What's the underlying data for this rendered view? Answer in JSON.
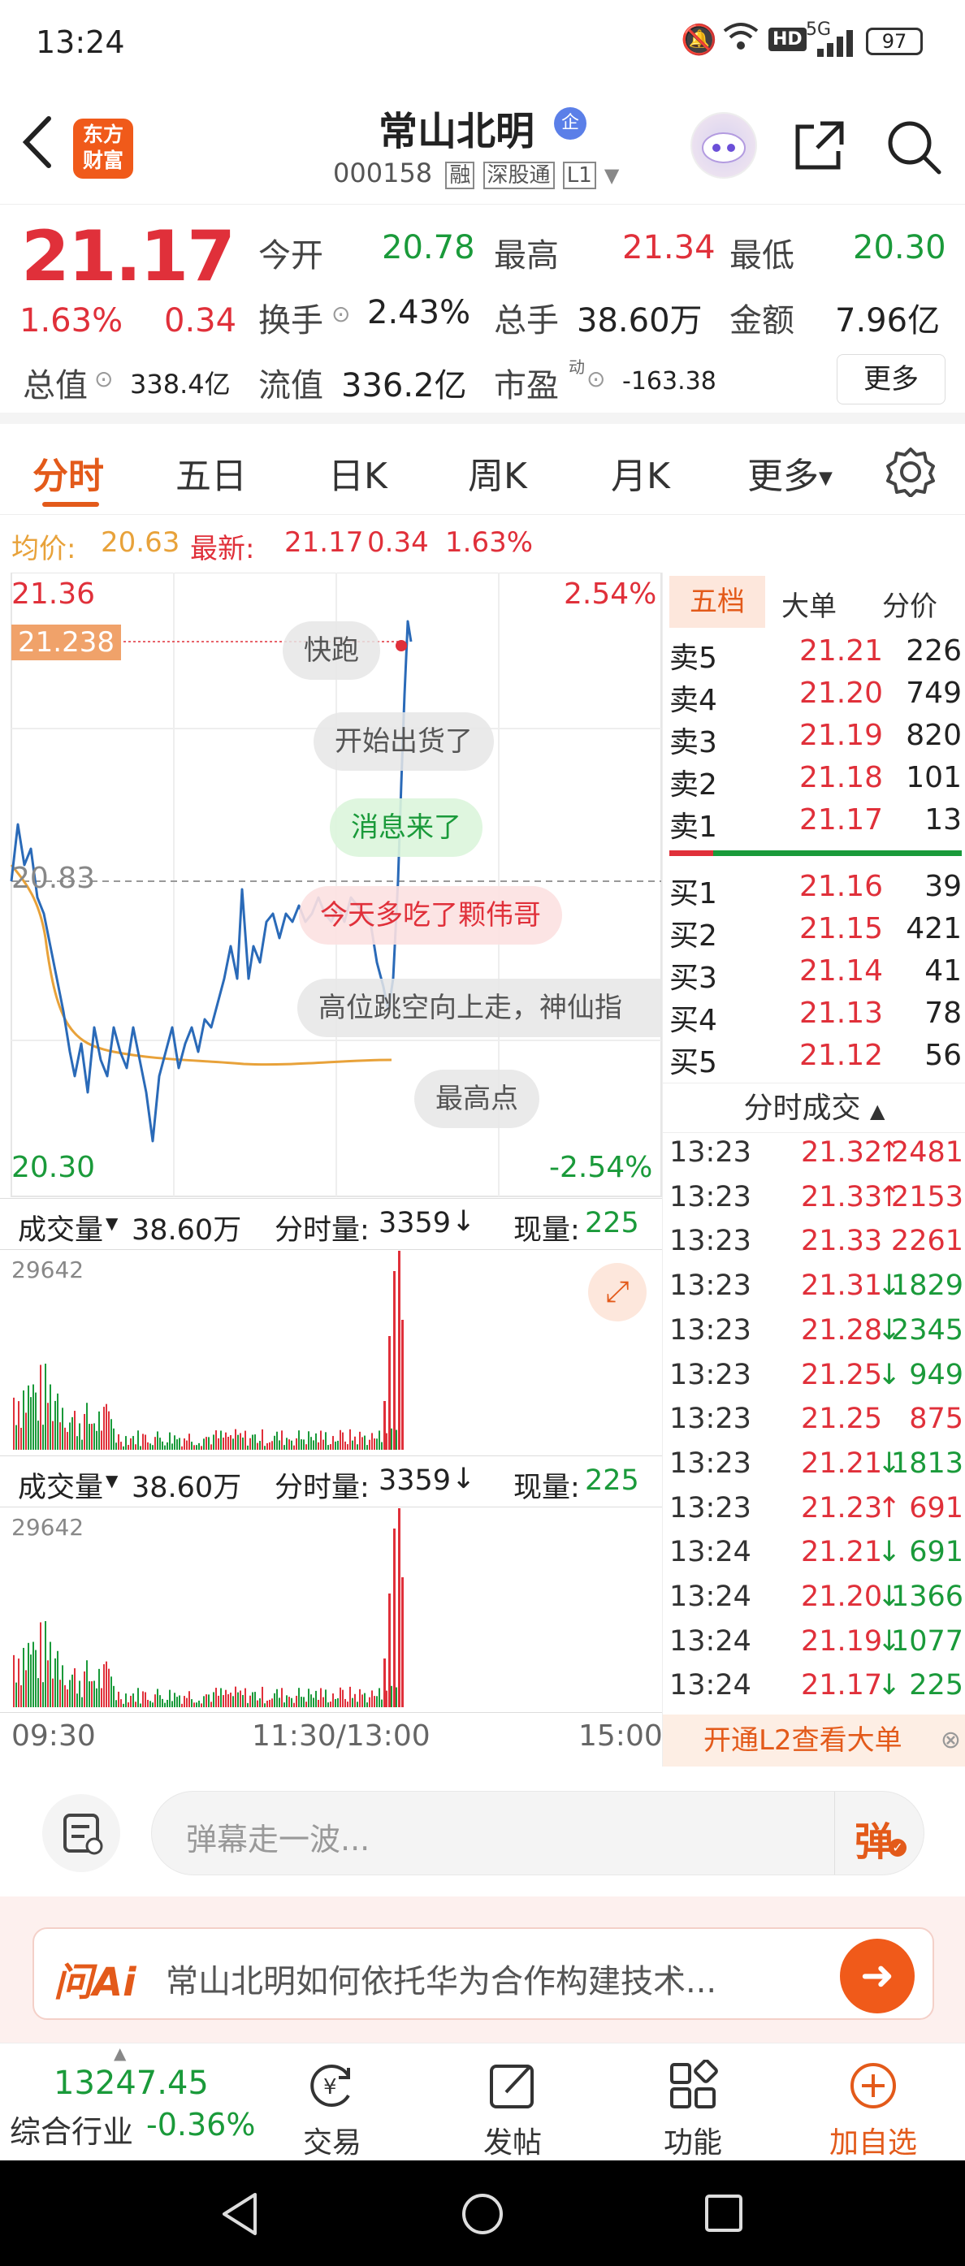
{
  "status": {
    "time": "13:24",
    "network": "5G",
    "battery": "97"
  },
  "header": {
    "name": "常山北明",
    "badge": "企",
    "code": "000158",
    "tags": [
      "融",
      "深股通",
      "L1"
    ],
    "logo_line1": "东方",
    "logo_line2": "财富"
  },
  "quote": {
    "price": "21.17",
    "change_pct": "1.63%",
    "change": "0.34",
    "open_label": "今开",
    "open": "20.78",
    "high_label": "最高",
    "high": "21.34",
    "low_label": "最低",
    "low": "20.30",
    "turnover_label": "换手",
    "turnover": "2.43%",
    "volume_label": "总手",
    "volume": "38.60万",
    "amount_label": "金额",
    "amount": "7.96亿",
    "mktcap_label": "总值",
    "mktcap": "338.4亿",
    "float_label": "流值",
    "float": "336.2亿",
    "pe_label": "市盈",
    "pe_sup": "动",
    "pe": "-163.38",
    "more_button": "更多"
  },
  "tabs": [
    "分时",
    "五日",
    "日K",
    "周K",
    "月K",
    "更多"
  ],
  "avg_line": {
    "avg_label": "均价:",
    "avg": "20.63",
    "latest_label": "最新:",
    "latest": "21.17",
    "chg": "0.34",
    "pct": "1.63%"
  },
  "chart": {
    "y_top": "21.36",
    "y_top_pct": "2.54%",
    "y_bottom": "20.30",
    "y_bottom_pct": "-2.54%",
    "mid": "20.83",
    "current_tag": "21.238",
    "x_labels": [
      "09:30",
      "11:30/13:00",
      "15:00"
    ]
  },
  "danmaku": [
    "快跑",
    "开始出货了",
    "消息来了",
    "今天多吃了颗伟哥",
    "高位跳空向上走，神仙指",
    "最高点"
  ],
  "volume_header": {
    "label": "成交量",
    "total": "38.60万",
    "minute_label": "分时量:",
    "minute": "3359",
    "current_label": "现量:",
    "current": "225",
    "max": "29642"
  },
  "orderbook": {
    "tabs": [
      "五档",
      "大单",
      "分价"
    ],
    "asks": [
      {
        "label": "卖5",
        "price": "21.21",
        "vol": "226"
      },
      {
        "label": "卖4",
        "price": "21.20",
        "vol": "749"
      },
      {
        "label": "卖3",
        "price": "21.19",
        "vol": "820"
      },
      {
        "label": "卖2",
        "price": "21.18",
        "vol": "101"
      },
      {
        "label": "卖1",
        "price": "21.17",
        "vol": "13"
      }
    ],
    "bids": [
      {
        "label": "买1",
        "price": "21.16",
        "vol": "39"
      },
      {
        "label": "买2",
        "price": "21.15",
        "vol": "421"
      },
      {
        "label": "买3",
        "price": "21.14",
        "vol": "41"
      },
      {
        "label": "买4",
        "price": "21.13",
        "vol": "78"
      },
      {
        "label": "买5",
        "price": "21.12",
        "vol": "56"
      }
    ]
  },
  "trades": {
    "title": "分时成交",
    "rows": [
      {
        "t": "13:23",
        "p": "21.32",
        "d": "up",
        "v": "2481"
      },
      {
        "t": "13:23",
        "p": "21.33",
        "d": "up",
        "v": "2153"
      },
      {
        "t": "13:23",
        "p": "21.33",
        "d": "",
        "v": "2261"
      },
      {
        "t": "13:23",
        "p": "21.31",
        "d": "down",
        "v": "1829"
      },
      {
        "t": "13:23",
        "p": "21.28",
        "d": "down",
        "v": "2345"
      },
      {
        "t": "13:23",
        "p": "21.25",
        "d": "down",
        "v": "949"
      },
      {
        "t": "13:23",
        "p": "21.25",
        "d": "",
        "v": "875"
      },
      {
        "t": "13:23",
        "p": "21.21",
        "d": "down",
        "v": "1813"
      },
      {
        "t": "13:23",
        "p": "21.23",
        "d": "up",
        "v": "691"
      },
      {
        "t": "13:24",
        "p": "21.21",
        "d": "down",
        "v": "691"
      },
      {
        "t": "13:24",
        "p": "21.20",
        "d": "down",
        "v": "1366"
      },
      {
        "t": "13:24",
        "p": "21.19",
        "d": "down",
        "v": "1077"
      },
      {
        "t": "13:24",
        "p": "21.17",
        "d": "down",
        "v": "225"
      }
    ],
    "l2_banner": "开通L2查看大单"
  },
  "comment_input": {
    "placeholder": "弹幕走一波...",
    "danmaku_button": "弹"
  },
  "ask_ai": {
    "logo": "问Ai",
    "text": "常山北明如何依托华为合作构建技术..."
  },
  "bottom_nav": {
    "index_value": "13247.45",
    "index_name": "综合行业",
    "index_pct": "-0.36%",
    "items": [
      "交易",
      "发帖",
      "功能",
      "加自选"
    ]
  },
  "colors": {
    "red": "#e0303a",
    "green": "#1a9a3a",
    "orange": "#f06a1a",
    "price_line": "#2a6ab8",
    "avg_line": "#e8a23a"
  }
}
